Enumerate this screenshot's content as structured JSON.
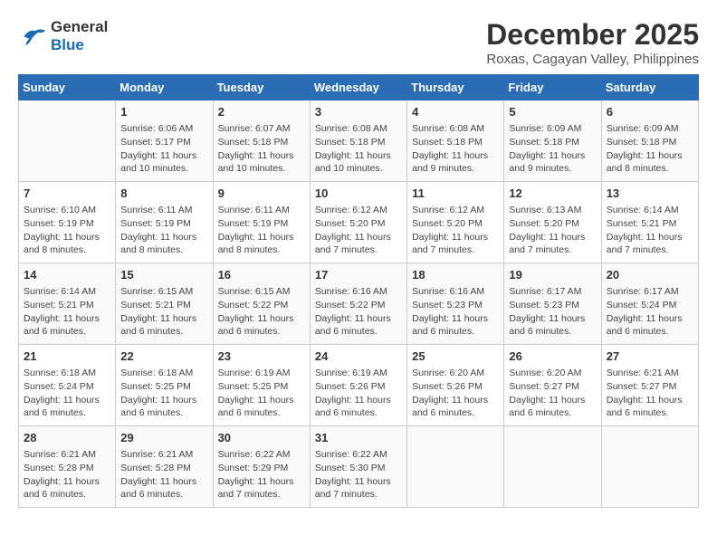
{
  "header": {
    "logo_line1": "General",
    "logo_line2": "Blue",
    "title": "December 2025",
    "subtitle": "Roxas, Cagayan Valley, Philippines"
  },
  "days_of_week": [
    "Sunday",
    "Monday",
    "Tuesday",
    "Wednesday",
    "Thursday",
    "Friday",
    "Saturday"
  ],
  "weeks": [
    [
      {
        "day": "",
        "info": ""
      },
      {
        "day": "1",
        "info": "Sunrise: 6:06 AM\nSunset: 5:17 PM\nDaylight: 11 hours\nand 10 minutes."
      },
      {
        "day": "2",
        "info": "Sunrise: 6:07 AM\nSunset: 5:18 PM\nDaylight: 11 hours\nand 10 minutes."
      },
      {
        "day": "3",
        "info": "Sunrise: 6:08 AM\nSunset: 5:18 PM\nDaylight: 11 hours\nand 10 minutes."
      },
      {
        "day": "4",
        "info": "Sunrise: 6:08 AM\nSunset: 5:18 PM\nDaylight: 11 hours\nand 9 minutes."
      },
      {
        "day": "5",
        "info": "Sunrise: 6:09 AM\nSunset: 5:18 PM\nDaylight: 11 hours\nand 9 minutes."
      },
      {
        "day": "6",
        "info": "Sunrise: 6:09 AM\nSunset: 5:18 PM\nDaylight: 11 hours\nand 8 minutes."
      }
    ],
    [
      {
        "day": "7",
        "info": "Sunrise: 6:10 AM\nSunset: 5:19 PM\nDaylight: 11 hours\nand 8 minutes."
      },
      {
        "day": "8",
        "info": "Sunrise: 6:11 AM\nSunset: 5:19 PM\nDaylight: 11 hours\nand 8 minutes."
      },
      {
        "day": "9",
        "info": "Sunrise: 6:11 AM\nSunset: 5:19 PM\nDaylight: 11 hours\nand 8 minutes."
      },
      {
        "day": "10",
        "info": "Sunrise: 6:12 AM\nSunset: 5:20 PM\nDaylight: 11 hours\nand 7 minutes."
      },
      {
        "day": "11",
        "info": "Sunrise: 6:12 AM\nSunset: 5:20 PM\nDaylight: 11 hours\nand 7 minutes."
      },
      {
        "day": "12",
        "info": "Sunrise: 6:13 AM\nSunset: 5:20 PM\nDaylight: 11 hours\nand 7 minutes."
      },
      {
        "day": "13",
        "info": "Sunrise: 6:14 AM\nSunset: 5:21 PM\nDaylight: 11 hours\nand 7 minutes."
      }
    ],
    [
      {
        "day": "14",
        "info": "Sunrise: 6:14 AM\nSunset: 5:21 PM\nDaylight: 11 hours\nand 6 minutes."
      },
      {
        "day": "15",
        "info": "Sunrise: 6:15 AM\nSunset: 5:21 PM\nDaylight: 11 hours\nand 6 minutes."
      },
      {
        "day": "16",
        "info": "Sunrise: 6:15 AM\nSunset: 5:22 PM\nDaylight: 11 hours\nand 6 minutes."
      },
      {
        "day": "17",
        "info": "Sunrise: 6:16 AM\nSunset: 5:22 PM\nDaylight: 11 hours\nand 6 minutes."
      },
      {
        "day": "18",
        "info": "Sunrise: 6:16 AM\nSunset: 5:23 PM\nDaylight: 11 hours\nand 6 minutes."
      },
      {
        "day": "19",
        "info": "Sunrise: 6:17 AM\nSunset: 5:23 PM\nDaylight: 11 hours\nand 6 minutes."
      },
      {
        "day": "20",
        "info": "Sunrise: 6:17 AM\nSunset: 5:24 PM\nDaylight: 11 hours\nand 6 minutes."
      }
    ],
    [
      {
        "day": "21",
        "info": "Sunrise: 6:18 AM\nSunset: 5:24 PM\nDaylight: 11 hours\nand 6 minutes."
      },
      {
        "day": "22",
        "info": "Sunrise: 6:18 AM\nSunset: 5:25 PM\nDaylight: 11 hours\nand 6 minutes."
      },
      {
        "day": "23",
        "info": "Sunrise: 6:19 AM\nSunset: 5:25 PM\nDaylight: 11 hours\nand 6 minutes."
      },
      {
        "day": "24",
        "info": "Sunrise: 6:19 AM\nSunset: 5:26 PM\nDaylight: 11 hours\nand 6 minutes."
      },
      {
        "day": "25",
        "info": "Sunrise: 6:20 AM\nSunset: 5:26 PM\nDaylight: 11 hours\nand 6 minutes."
      },
      {
        "day": "26",
        "info": "Sunrise: 6:20 AM\nSunset: 5:27 PM\nDaylight: 11 hours\nand 6 minutes."
      },
      {
        "day": "27",
        "info": "Sunrise: 6:21 AM\nSunset: 5:27 PM\nDaylight: 11 hours\nand 6 minutes."
      }
    ],
    [
      {
        "day": "28",
        "info": "Sunrise: 6:21 AM\nSunset: 5:28 PM\nDaylight: 11 hours\nand 6 minutes."
      },
      {
        "day": "29",
        "info": "Sunrise: 6:21 AM\nSunset: 5:28 PM\nDaylight: 11 hours\nand 6 minutes."
      },
      {
        "day": "30",
        "info": "Sunrise: 6:22 AM\nSunset: 5:29 PM\nDaylight: 11 hours\nand 7 minutes."
      },
      {
        "day": "31",
        "info": "Sunrise: 6:22 AM\nSunset: 5:30 PM\nDaylight: 11 hours\nand 7 minutes."
      },
      {
        "day": "",
        "info": ""
      },
      {
        "day": "",
        "info": ""
      },
      {
        "day": "",
        "info": ""
      }
    ]
  ]
}
